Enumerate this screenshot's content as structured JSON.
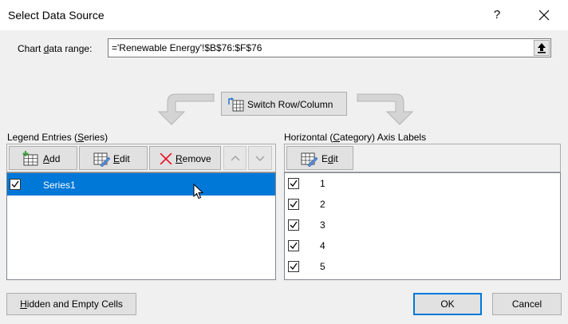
{
  "window": {
    "title": "Select Data Source",
    "help_label": "?"
  },
  "range": {
    "label_pre": "Chart ",
    "label_ul": "d",
    "label_post": "ata range:",
    "value": "='Renewable Energy'!$B$76:$F$76"
  },
  "switch": {
    "label_ul": "W",
    "label_post": "Switch Row/Column"
  },
  "legend": {
    "label_pre": "Legend Entries (",
    "label_ul": "S",
    "label_post": "eries)",
    "add_ul": "A",
    "add_post": "dd",
    "edit_ul": "E",
    "edit_post": "dit",
    "remove_ul": "R",
    "remove_post": "emove",
    "series": [
      {
        "name": "Series1",
        "checked": true,
        "selected": true
      }
    ]
  },
  "axis": {
    "label_pre": "Horizontal (",
    "label_ul": "C",
    "label_post": "ategory) Axis Labels",
    "edit_ul": "d",
    "edit_pre": "E",
    "edit_post": "it",
    "items": [
      {
        "label": "1",
        "checked": true
      },
      {
        "label": "2",
        "checked": true
      },
      {
        "label": "3",
        "checked": true
      },
      {
        "label": "4",
        "checked": true
      },
      {
        "label": "5",
        "checked": true
      }
    ]
  },
  "footer": {
    "hidden_ul": "H",
    "hidden_post": "idden and Empty Cells",
    "ok": "OK",
    "cancel": "Cancel"
  },
  "colors": {
    "accent": "#0078d7",
    "arrow_gray": "#c8c8c8",
    "remove_red": "#e81123"
  }
}
